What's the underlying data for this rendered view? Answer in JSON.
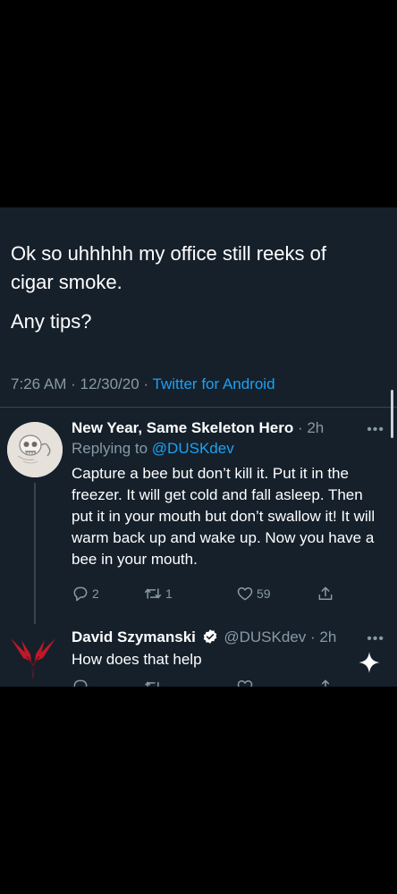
{
  "main_tweet": {
    "line1": "Ok so uhhhhh my office still reeks of",
    "line2": "cigar smoke.",
    "line3": "Any tips?",
    "time": "7:26 AM",
    "date": "12/30/20",
    "source": "Twitter for Android",
    "separator": "·"
  },
  "reply1": {
    "name": "New Year, Same Skeleton Hero",
    "time": "· 2h",
    "replying_prefix": "Replying to",
    "replying_handle": "@DUSKdev",
    "text": "Capture a bee but don’t kill it. Put it in the freezer. It will get cold and fall asleep. Then put it in your mouth but don’t swallow it! It will warm back up and wake up. Now you have a bee in your mouth.",
    "replies": "2",
    "retweets": "1",
    "likes": "59",
    "more": "•••"
  },
  "reply2": {
    "name": "David Szymanski",
    "handle": "@DUSKdev",
    "time": "· 2h",
    "text": "How does that help",
    "more": "•••"
  },
  "icons": {
    "reply": "reply-icon",
    "retweet": "retweet-icon",
    "like": "heart-icon",
    "share": "share-icon",
    "verified": "verified-badge-icon",
    "compose": "sparkle-icon"
  },
  "colors": {
    "background": "#15202b",
    "text": "#ffffff",
    "muted": "#8899a6",
    "accent": "#1da1f2",
    "divider": "#38444d"
  }
}
